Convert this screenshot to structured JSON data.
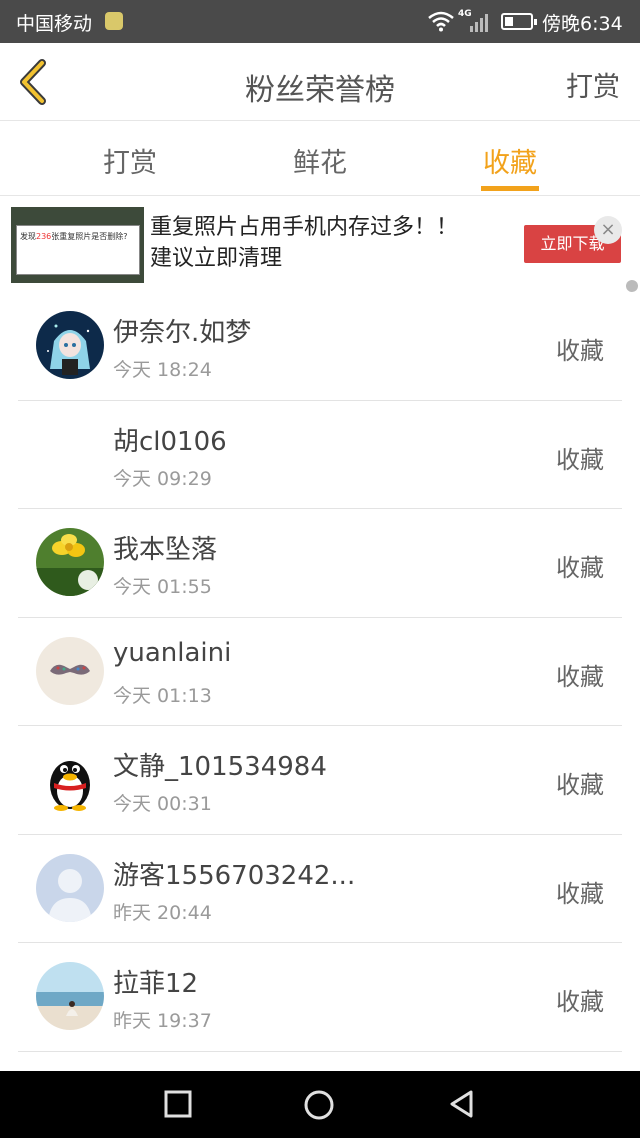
{
  "status_bar": {
    "carrier": "中国移动",
    "network": "4G",
    "time": "傍晚6:34",
    "battery_level": 0.35
  },
  "header": {
    "back_icon": "chevron-left-icon",
    "title": "粉丝荣誉榜",
    "right_action": "打赏",
    "accent_color": "#f2a21b"
  },
  "tabs": [
    {
      "label": "打赏",
      "active": false
    },
    {
      "label": "鲜花",
      "active": false
    },
    {
      "label": "收藏",
      "active": true
    }
  ],
  "ad": {
    "thumb_text_prefix": "发现",
    "thumb_text_count": "236",
    "thumb_text_suffix": "张重复照片是否删除?",
    "text_line1": "重复照片占用手机内存过多！！",
    "text_line2": "建议立即清理",
    "button": "立即下载"
  },
  "list": [
    {
      "name": "伊奈尔.如梦",
      "time": "今天 18:24",
      "action": "收藏",
      "avatar": "anime-avatar"
    },
    {
      "name": "胡cl0106",
      "time": "今天 09:29",
      "action": "收藏",
      "avatar": "none"
    },
    {
      "name": "我本坠落",
      "time": "今天 01:55",
      "action": "收藏",
      "avatar": "flower-avatar"
    },
    {
      "name": "yuanlaini",
      "time": "今天 01:13",
      "action": "收藏",
      "avatar": "mustache-avatar"
    },
    {
      "name": "文静_101534984",
      "time": "今天 00:31",
      "action": "收藏",
      "avatar": "penguin-avatar"
    },
    {
      "name": "游客1556703242...",
      "time": "昨天 20:44",
      "action": "收藏",
      "avatar": "default-user-avatar"
    },
    {
      "name": "拉菲12",
      "time": "昨天 19:37",
      "action": "收藏",
      "avatar": "beach-avatar"
    }
  ]
}
